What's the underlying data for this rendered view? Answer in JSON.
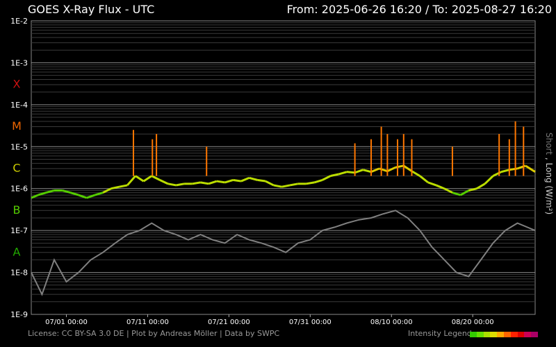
{
  "header": {
    "title": "GOES X-Ray Flux - UTC",
    "range": "From: 2025-06-26 16:20  /  To: 2025-08-27 16:20"
  },
  "footer": {
    "license": "License: CC BY-SA 3.0 DE | Plot by Andreas Möller | Data by SWPC",
    "legend_label": "Intensity Legend",
    "legend_colors": [
      "#33cc00",
      "#66dd00",
      "#aadd00",
      "#dddd00",
      "#ffaa00",
      "#ff6600",
      "#ff2200",
      "#dd0000",
      "#cc0055",
      "#aa0066"
    ]
  },
  "chart_data": {
    "type": "line",
    "title": "GOES X-Ray Flux - UTC",
    "ylabel_short": "Short",
    "ylabel_long": "Long (W/m²)",
    "ylabel_sep": ",",
    "yscale": "log",
    "ylim": [
      1e-09,
      0.01
    ],
    "y_ticks": [
      "1E-9",
      "1E-8",
      "1E-7",
      "1E-6",
      "1E-5",
      "1E-4",
      "1E-3",
      "1E-2"
    ],
    "flare_classes": [
      {
        "label": "A",
        "color": "#22aa00",
        "level": 1e-08
      },
      {
        "label": "B",
        "color": "#55cc00",
        "level": 1e-07
      },
      {
        "label": "C",
        "color": "#cccc00",
        "level": 1e-06
      },
      {
        "label": "M",
        "color": "#ee6600",
        "level": 1e-05
      },
      {
        "label": "X",
        "color": "#cc1111",
        "level": 0.0001
      }
    ],
    "x_range": [
      "2025-06-26 16:20",
      "2025-08-27 16:20"
    ],
    "x_ticks": [
      {
        "date": "2025-07-01 00:00",
        "label": "07/01 00:00"
      },
      {
        "date": "2025-07-11 00:00",
        "label": "07/11 00:00"
      },
      {
        "date": "2025-07-21 00:00",
        "label": "07/21 00:00"
      },
      {
        "date": "2025-07-31 00:00",
        "label": "07/31 00:00"
      },
      {
        "date": "2025-08-10 00:00",
        "label": "08/10 00:00"
      },
      {
        "date": "2025-08-20 00:00",
        "label": "08/20 00:00"
      }
    ],
    "grid": true,
    "series": [
      {
        "name": "Long",
        "color_by_intensity": true,
        "points": [
          [
            "2025-06-26 16:20",
            6e-07
          ],
          [
            "2025-06-27 12:00",
            7e-07
          ],
          [
            "2025-06-28 12:00",
            8e-07
          ],
          [
            "2025-06-29 12:00",
            9e-07
          ],
          [
            "2025-06-30 12:00",
            9e-07
          ],
          [
            "2025-07-01 12:00",
            8e-07
          ],
          [
            "2025-07-02 12:00",
            7e-07
          ],
          [
            "2025-07-03 12:00",
            6e-07
          ],
          [
            "2025-07-04 12:00",
            7e-07
          ],
          [
            "2025-07-05 12:00",
            8e-07
          ],
          [
            "2025-07-06 12:00",
            1e-06
          ],
          [
            "2025-07-07 12:00",
            1.1e-06
          ],
          [
            "2025-07-08 12:00",
            1.2e-06
          ],
          [
            "2025-07-09 12:00",
            2e-06
          ],
          [
            "2025-07-10 12:00",
            1.5e-06
          ],
          [
            "2025-07-11 12:00",
            2e-06
          ],
          [
            "2025-07-12 12:00",
            1.6e-06
          ],
          [
            "2025-07-13 12:00",
            1.3e-06
          ],
          [
            "2025-07-14 12:00",
            1.2e-06
          ],
          [
            "2025-07-15 12:00",
            1.3e-06
          ],
          [
            "2025-07-16 12:00",
            1.3e-06
          ],
          [
            "2025-07-17 12:00",
            1.4e-06
          ],
          [
            "2025-07-18 12:00",
            1.3e-06
          ],
          [
            "2025-07-19 12:00",
            1.5e-06
          ],
          [
            "2025-07-20 12:00",
            1.4e-06
          ],
          [
            "2025-07-21 12:00",
            1.6e-06
          ],
          [
            "2025-07-22 12:00",
            1.5e-06
          ],
          [
            "2025-07-23 12:00",
            1.8e-06
          ],
          [
            "2025-07-24 12:00",
            1.6e-06
          ],
          [
            "2025-07-25 12:00",
            1.5e-06
          ],
          [
            "2025-07-26 12:00",
            1.2e-06
          ],
          [
            "2025-07-27 12:00",
            1.1e-06
          ],
          [
            "2025-07-28 12:00",
            1.2e-06
          ],
          [
            "2025-07-29 12:00",
            1.3e-06
          ],
          [
            "2025-07-30 12:00",
            1.3e-06
          ],
          [
            "2025-07-31 12:00",
            1.4e-06
          ],
          [
            "2025-08-01 12:00",
            1.6e-06
          ],
          [
            "2025-08-02 12:00",
            2e-06
          ],
          [
            "2025-08-03 12:00",
            2.2e-06
          ],
          [
            "2025-08-04 12:00",
            2.5e-06
          ],
          [
            "2025-08-05 12:00",
            2.4e-06
          ],
          [
            "2025-08-06 12:00",
            2.8e-06
          ],
          [
            "2025-08-07 12:00",
            2.5e-06
          ],
          [
            "2025-08-08 12:00",
            3e-06
          ],
          [
            "2025-08-09 12:00",
            2.6e-06
          ],
          [
            "2025-08-10 12:00",
            3.2e-06
          ],
          [
            "2025-08-11 12:00",
            3.5e-06
          ],
          [
            "2025-08-12 12:00",
            2.6e-06
          ],
          [
            "2025-08-13 12:00",
            2e-06
          ],
          [
            "2025-08-14 12:00",
            1.4e-06
          ],
          [
            "2025-08-15 12:00",
            1.2e-06
          ],
          [
            "2025-08-16 12:00",
            1e-06
          ],
          [
            "2025-08-17 12:00",
            8e-07
          ],
          [
            "2025-08-18 12:00",
            7e-07
          ],
          [
            "2025-08-19 12:00",
            9e-07
          ],
          [
            "2025-08-20 12:00",
            1e-06
          ],
          [
            "2025-08-21 12:00",
            1.3e-06
          ],
          [
            "2025-08-22 12:00",
            2e-06
          ],
          [
            "2025-08-23 12:00",
            2.5e-06
          ],
          [
            "2025-08-24 12:00",
            2.8e-06
          ],
          [
            "2025-08-25 12:00",
            3e-06
          ],
          [
            "2025-08-26 12:00",
            3.5e-06
          ],
          [
            "2025-08-27 16:20",
            2.5e-06
          ]
        ],
        "peaks": [
          [
            "2025-07-09 06:00",
            2.5e-05
          ],
          [
            "2025-07-11 14:00",
            1.5e-05
          ],
          [
            "2025-07-12 02:00",
            2e-05
          ],
          [
            "2025-07-18 06:00",
            1e-05
          ],
          [
            "2025-08-05 12:00",
            1.2e-05
          ],
          [
            "2025-08-07 12:00",
            1.5e-05
          ],
          [
            "2025-08-08 18:00",
            3e-05
          ],
          [
            "2025-08-09 12:00",
            2e-05
          ],
          [
            "2025-08-10 18:00",
            1.5e-05
          ],
          [
            "2025-08-11 12:00",
            2e-05
          ],
          [
            "2025-08-12 12:00",
            1.5e-05
          ],
          [
            "2025-08-17 12:00",
            1e-05
          ],
          [
            "2025-08-23 06:00",
            2e-05
          ],
          [
            "2025-08-24 12:00",
            1.5e-05
          ],
          [
            "2025-08-25 06:00",
            4e-05
          ],
          [
            "2025-08-26 06:00",
            3e-05
          ]
        ]
      },
      {
        "name": "Short",
        "color": "#808080",
        "points": [
          [
            "2025-06-26 16:20",
            1e-08
          ],
          [
            "2025-06-28 00:00",
            3e-09
          ],
          [
            "2025-06-29 12:00",
            2e-08
          ],
          [
            "2025-07-01 00:00",
            6e-09
          ],
          [
            "2025-07-02 12:00",
            1e-08
          ],
          [
            "2025-07-04 00:00",
            2e-08
          ],
          [
            "2025-07-05 12:00",
            3e-08
          ],
          [
            "2025-07-07 00:00",
            5e-08
          ],
          [
            "2025-07-08 12:00",
            8e-08
          ],
          [
            "2025-07-10 00:00",
            1e-07
          ],
          [
            "2025-07-11 12:00",
            1.5e-07
          ],
          [
            "2025-07-13 00:00",
            1e-07
          ],
          [
            "2025-07-14 12:00",
            8e-08
          ],
          [
            "2025-07-16 00:00",
            6e-08
          ],
          [
            "2025-07-17 12:00",
            8e-08
          ],
          [
            "2025-07-19 00:00",
            6e-08
          ],
          [
            "2025-07-20 12:00",
            5e-08
          ],
          [
            "2025-07-22 00:00",
            8e-08
          ],
          [
            "2025-07-23 12:00",
            6e-08
          ],
          [
            "2025-07-25 00:00",
            5e-08
          ],
          [
            "2025-07-26 12:00",
            4e-08
          ],
          [
            "2025-07-28 00:00",
            3e-08
          ],
          [
            "2025-07-29 12:00",
            5e-08
          ],
          [
            "2025-07-31 00:00",
            6e-08
          ],
          [
            "2025-08-01 12:00",
            1e-07
          ],
          [
            "2025-08-03 00:00",
            1.2e-07
          ],
          [
            "2025-08-04 12:00",
            1.5e-07
          ],
          [
            "2025-08-06 00:00",
            1.8e-07
          ],
          [
            "2025-08-07 12:00",
            2e-07
          ],
          [
            "2025-08-09 00:00",
            2.5e-07
          ],
          [
            "2025-08-10 12:00",
            3e-07
          ],
          [
            "2025-08-12 00:00",
            2e-07
          ],
          [
            "2025-08-13 12:00",
            1e-07
          ],
          [
            "2025-08-15 00:00",
            4e-08
          ],
          [
            "2025-08-16 12:00",
            2e-08
          ],
          [
            "2025-08-18 00:00",
            1e-08
          ],
          [
            "2025-08-19 12:00",
            8e-09
          ],
          [
            "2025-08-21 00:00",
            2e-08
          ],
          [
            "2025-08-22 12:00",
            5e-08
          ],
          [
            "2025-08-24 00:00",
            1e-07
          ],
          [
            "2025-08-25 12:00",
            1.5e-07
          ],
          [
            "2025-08-27 16:20",
            1e-07
          ]
        ]
      }
    ]
  }
}
